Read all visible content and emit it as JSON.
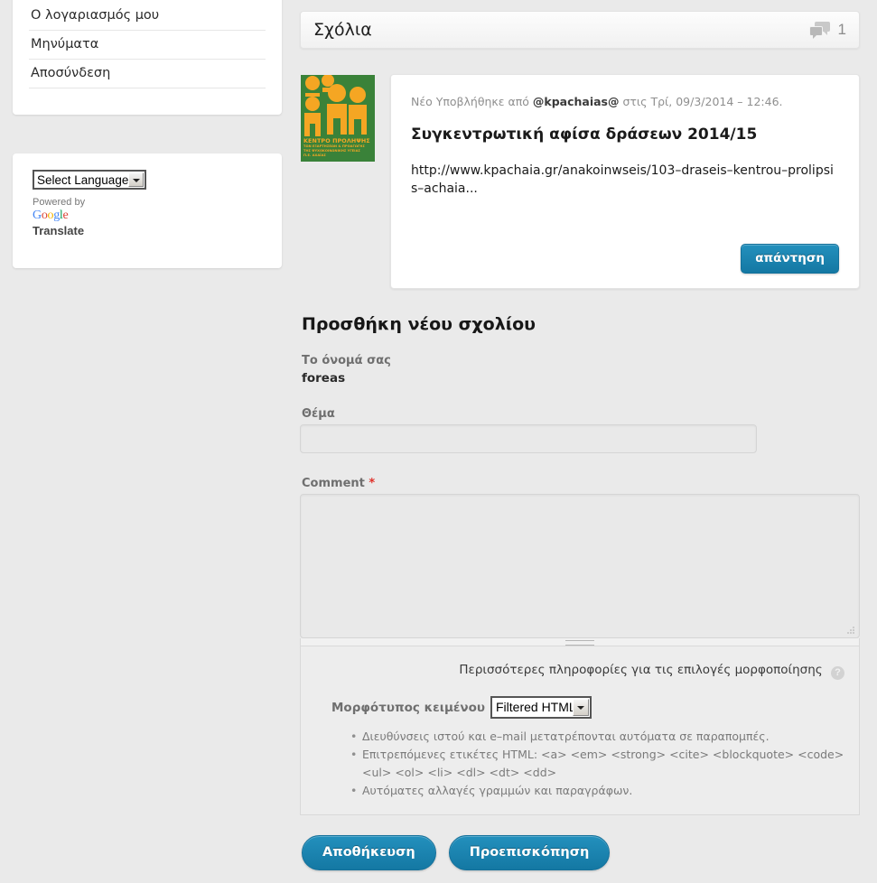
{
  "sidebar": {
    "account_menu": [
      {
        "label": "Ο λογαριασμός μου"
      },
      {
        "label": "Μηνύματα"
      },
      {
        "label": "Αποσύνδεση"
      }
    ],
    "translate": {
      "select_value": "Select Language",
      "powered_by": "Powered by",
      "google_letters": [
        "G",
        "o",
        "o",
        "g",
        "l",
        "e"
      ],
      "translate_label": "Translate"
    }
  },
  "comments": {
    "header_title": "Σχόλια",
    "count": "1",
    "bubble_icon": "comment-bubble-icon",
    "items": [
      {
        "submitted_prefix": "Νέο Υποβλήθηκε από ",
        "author": "@kpachaias@",
        "submitted_middle": " στις ",
        "date": "Τρί, 09/3/2014 – 12:46.",
        "title": "Συγκεντρωτική αφίσα δράσεων 2014/15",
        "body": "http://www.kpachaia.gr/anakoinwseis/103–draseis–kentrou–prolipsis–achaia...",
        "reply_label": "απάντηση",
        "avatar": {
          "line1": "ΚΕΝΤΡΟ ΠΡΟΛΗΨΗΣ",
          "line2": "ΤΩΝ ΕΞΑΡΤΗΣΕΩΝ & ΠΡΟΑΓΩΓΗΣ",
          "line3": "ΤΗΣ ΨΥΧΟΚΟΙΝΩΝΙΚΗΣ ΥΓΕΙΑΣ",
          "line4": "Π.Ε. ΑΧΑΪΑΣ"
        }
      }
    ]
  },
  "form": {
    "title": "Προσθήκη νέου σχολίου",
    "name_label": "Το όνομά σας",
    "name_value": "foreas",
    "subject_label": "Θέμα",
    "subject_value": "",
    "subject_placeholder": "",
    "comment_label": "Comment",
    "comment_required_mark": "*",
    "comment_value": "",
    "comment_placeholder": "",
    "filter_tips_text": "Περισσότερες πληροφορίες για τις επιλογές μορφοποίησης",
    "help_icon_glyph": "?",
    "format_label": "Μορφότυπος κειμένου",
    "format_value": "Filtered HTML",
    "format_options": [
      "Filtered HTML"
    ],
    "tips": [
      "Διευθύνσεις ιστού και e–mail μετατρέπονται αυτόματα σε παραπομπές.",
      "Επιτρεπόμενες ετικέτες HTML: <a> <em> <strong> <cite> <blockquote> <code> <ul> <ol> <li> <dl> <dt> <dd>",
      "Αυτόματες αλλαγές γραμμών και παραγράφων."
    ],
    "save_label": "Αποθήκευση",
    "preview_label": "Προεπισκόπηση"
  },
  "colors": {
    "page_background": "#eaeaea",
    "accent_button": "#1b83ae",
    "required_red": "#e0312a",
    "avatar_green": "#3a8239",
    "avatar_orange": "#f5a623",
    "muted_text": "#7a7a7a"
  }
}
